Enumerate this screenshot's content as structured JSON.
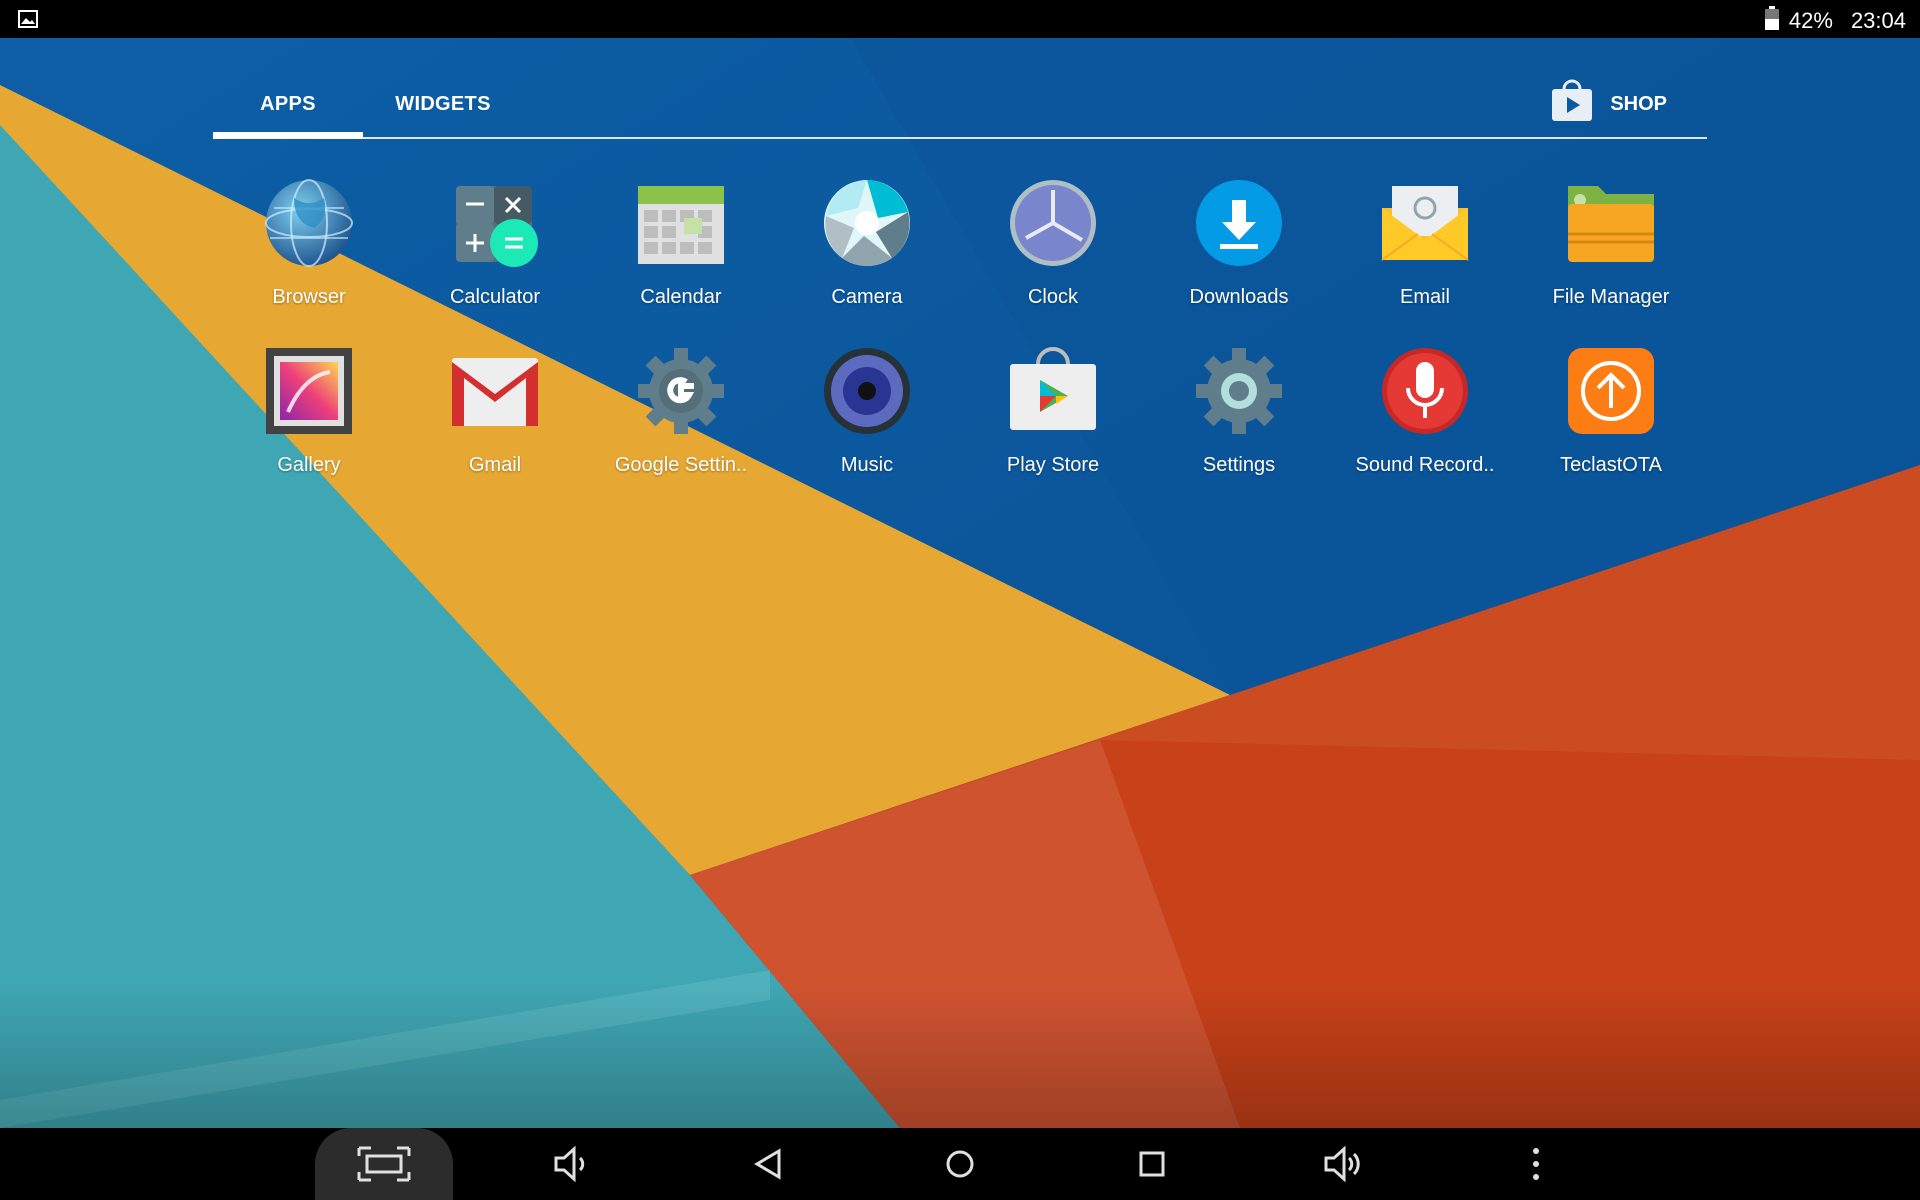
{
  "status_bar": {
    "battery_percent": "42%",
    "time": "23:04"
  },
  "tabs": {
    "apps_label": "APPS",
    "widgets_label": "WIDGETS",
    "shop_label": "SHOP"
  },
  "apps": [
    {
      "label": "Browser",
      "icon": "globe-icon"
    },
    {
      "label": "Calculator",
      "icon": "calculator-icon"
    },
    {
      "label": "Calendar",
      "icon": "calendar-icon"
    },
    {
      "label": "Camera",
      "icon": "camera-aperture-icon"
    },
    {
      "label": "Clock",
      "icon": "clock-icon"
    },
    {
      "label": "Downloads",
      "icon": "download-icon"
    },
    {
      "label": "Email",
      "icon": "envelope-icon"
    },
    {
      "label": "File Manager",
      "icon": "folder-icon"
    },
    {
      "label": "Gallery",
      "icon": "picture-frame-icon"
    },
    {
      "label": "Gmail",
      "icon": "gmail-icon"
    },
    {
      "label": "Google Settin..",
      "icon": "google-gear-icon"
    },
    {
      "label": "Music",
      "icon": "speaker-icon"
    },
    {
      "label": "Play Store",
      "icon": "play-store-icon"
    },
    {
      "label": "Settings",
      "icon": "gear-icon"
    },
    {
      "label": "Sound Record..",
      "icon": "microphone-icon"
    },
    {
      "label": "TeclastOTA",
      "icon": "upload-arrow-icon"
    }
  ],
  "colors": {
    "wallpaper_blue": "#0a5aa0",
    "wallpaper_teal": "#3ea6b4",
    "wallpaper_yellow": "#e6a733",
    "wallpaper_orange": "#cf4b20"
  }
}
